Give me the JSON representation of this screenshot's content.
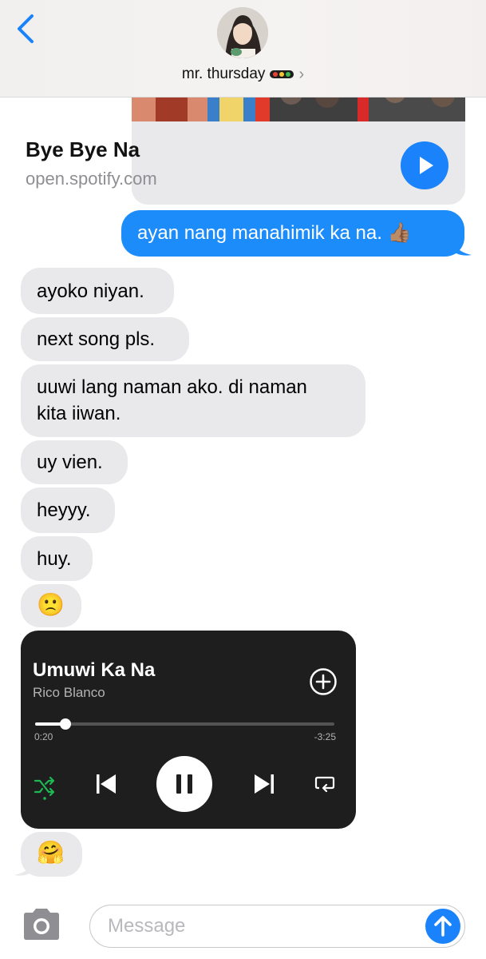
{
  "header": {
    "contact_name": "mr. thursday",
    "chevron": "›"
  },
  "link_preview": {
    "title": "Bye Bye Na",
    "domain": "open.spotify.com"
  },
  "messages": [
    {
      "direction": "outgoing",
      "text": "ayan nang manahimik ka na. 👍🏽"
    },
    {
      "direction": "incoming",
      "text": "ayoko niyan."
    },
    {
      "direction": "incoming",
      "text": "next song pls."
    },
    {
      "direction": "incoming",
      "line1": "uuwi lang naman ako. di naman",
      "line2": "kita iiwan."
    },
    {
      "direction": "incoming",
      "text": "uy vien."
    },
    {
      "direction": "incoming",
      "text": "heyyy."
    },
    {
      "direction": "incoming",
      "text": "huy."
    },
    {
      "direction": "incoming",
      "text": "🙁"
    },
    {
      "direction": "incoming",
      "text": "🤗"
    }
  ],
  "player": {
    "song": "Umuwi Ka Na",
    "artist": "Rico Blanco",
    "elapsed": "0:20",
    "remaining": "-3:25",
    "progress_fraction": 0.1
  },
  "input": {
    "placeholder": "Message"
  },
  "colors": {
    "outgoing_bubble": "#1c8cfb",
    "incoming_bubble": "#e9e9eb",
    "ios_blue": "#1a82fb",
    "spotify_green": "#1db954",
    "player_bg": "#1e1e1e"
  },
  "icons": [
    "back-chevron-icon",
    "traffic-light-icon",
    "play-icon",
    "add-circle-icon",
    "shuffle-icon",
    "previous-icon",
    "pause-icon",
    "next-icon",
    "repeat-icon",
    "camera-icon",
    "send-arrow-icon"
  ]
}
